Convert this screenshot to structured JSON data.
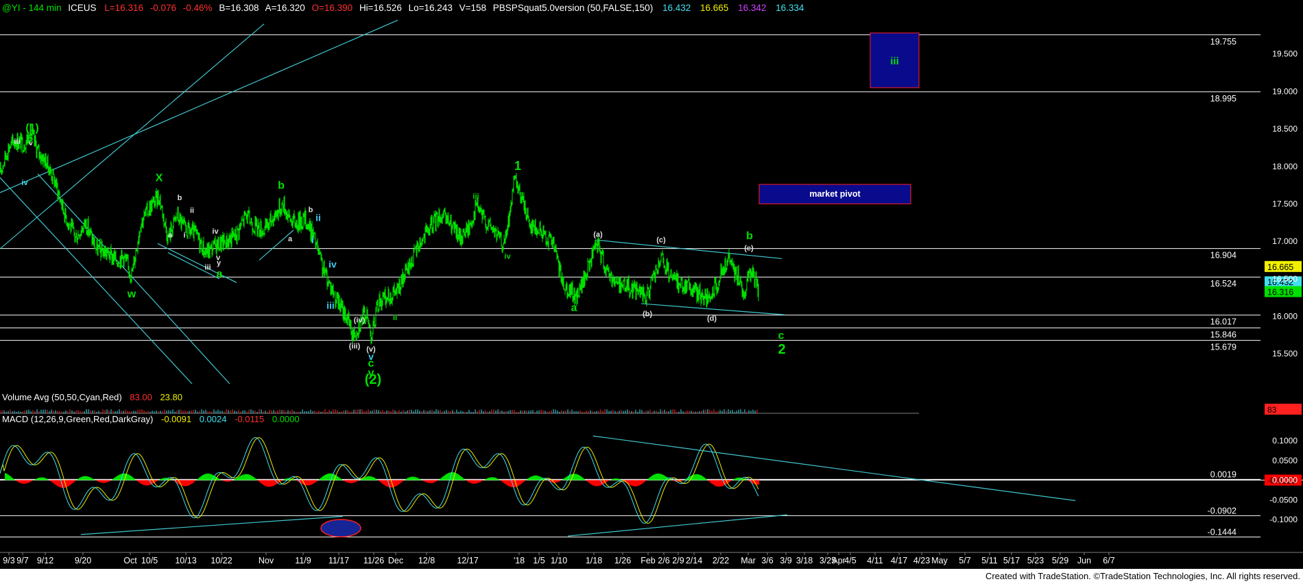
{
  "header": {
    "symbol": "@YI - 144 min",
    "exchange": "ICEUS",
    "last": "L=16.316",
    "change": "-0.076",
    "pct": "-0.46%",
    "bid": "B=16.308",
    "ask": "A=16.320",
    "open": "O=16.390",
    "high": "Hi=16.526",
    "low": "Lo=16.243",
    "volume": "V=158",
    "indicator": "PBSPSquat5.0version (50,FALSE,150)",
    "ind_values": [
      {
        "text": "16.432",
        "color": "#40e0f0"
      },
      {
        "text": "16.665",
        "color": "#f0f000"
      },
      {
        "text": "16.342",
        "color": "#d040ff"
      },
      {
        "text": "16.334",
        "color": "#40e0f0"
      }
    ]
  },
  "volume_panel": {
    "label": "Volume Avg (50,50,Cyan,Red)",
    "v1": "83.00",
    "v2": "23.80",
    "axis_badge": "83"
  },
  "macd_panel": {
    "label": "MACD (12,26,9,Green,Red,DarkGray)",
    "v1": "-0.0091",
    "v2": "0.0024",
    "v3": "-0.0115",
    "v4": "0.0000"
  },
  "footer": {
    "credit": "Created with TradeStation. ©TradeStation Technologies, Inc. All rights reserved."
  },
  "chart_data": {
    "type": "line",
    "symbol": "@YI",
    "interval": "144 min",
    "price_axis": {
      "ylim": [
        15.1,
        20.0
      ],
      "ticks": [
        "19.500",
        "19.000",
        "18.500",
        "18.000",
        "17.500",
        "17.000",
        "16.500",
        "16.000",
        "15.500"
      ]
    },
    "macd_axis": {
      "ylim": [
        -0.18,
        0.14
      ],
      "ticks": [
        "0.1000",
        "0.0500",
        "0.0000",
        "-0.0500",
        "-0.1000"
      ]
    },
    "x_tick_labels": [
      "9/3",
      "9/7",
      "9/12",
      "9/20",
      "Oct",
      "10/5",
      "10/13",
      "10/22",
      "Nov",
      "11/9",
      "11/17",
      "11/26",
      "Dec",
      "12/8",
      "12/17",
      "'18",
      "1/5",
      "1/10",
      "1/18",
      "1/26",
      "Feb",
      "2/6",
      "2/9",
      "2/14",
      "2/22",
      "Mar",
      "3/6",
      "3/9",
      "3/18",
      "3/25",
      "Apr",
      "4/5",
      "4/11",
      "4/17",
      "4/23",
      "May",
      "5/7",
      "5/11",
      "5/17",
      "5/23",
      "5/29",
      "Jun",
      "6/7"
    ],
    "horizontal_levels": [
      {
        "value": 19.755,
        "label": "19.755"
      },
      {
        "value": 18.995,
        "label": "18.995"
      },
      {
        "value": 16.904,
        "label": "16.904"
      },
      {
        "value": 16.524,
        "label": "16.524"
      },
      {
        "value": 16.017,
        "label": "16.017"
      },
      {
        "value": 15.846,
        "label": "15.846"
      },
      {
        "value": 15.679,
        "label": "15.679"
      }
    ],
    "macd_levels": [
      {
        "value": 0.0019,
        "label": "0.0019"
      },
      {
        "value": -0.0902,
        "label": "-0.0902"
      },
      {
        "value": -0.1444,
        "label": "-0.1444"
      }
    ],
    "price_badges": [
      {
        "text": "16.665",
        "value": 16.665,
        "bg": "#f0f000",
        "fg": "#000000"
      },
      {
        "text": "16.432",
        "value": 16.46,
        "bg": "#40e0f0",
        "fg": "#000000"
      },
      {
        "text": "16.316",
        "value": 16.33,
        "bg": "#00e000",
        "fg": "#000000"
      }
    ],
    "macd_badge": {
      "text": "-0.0115",
      "bg": "#ff0000",
      "fg": "#000000"
    },
    "boxes": [
      {
        "label": "market pivot",
        "i0": 1107,
        "i1": 1328,
        "p_hi": 17.76,
        "p_lo": 17.5
      },
      {
        "label": "iii",
        "i0": 1269,
        "i1": 1340,
        "p_hi": 19.78,
        "p_lo": 19.05
      }
    ],
    "price_path": [
      [
        0,
        17.92
      ],
      [
        12,
        18.25
      ],
      [
        22,
        18.35
      ],
      [
        35,
        18.3
      ],
      [
        45,
        18.45
      ],
      [
        55,
        18.2
      ],
      [
        68,
        18.05
      ],
      [
        80,
        17.8
      ],
      [
        95,
        17.35
      ],
      [
        110,
        17.05
      ],
      [
        125,
        17.25
      ],
      [
        140,
        16.9
      ],
      [
        155,
        16.85
      ],
      [
        170,
        16.75
      ],
      [
        180,
        16.8
      ],
      [
        192,
        16.55
      ],
      [
        205,
        17.25
      ],
      [
        218,
        17.45
      ],
      [
        232,
        17.6
      ],
      [
        245,
        17.05
      ],
      [
        258,
        17.35
      ],
      [
        270,
        17.15
      ],
      [
        285,
        17.1
      ],
      [
        300,
        16.85
      ],
      [
        315,
        16.95
      ],
      [
        330,
        17.0
      ],
      [
        345,
        17.1
      ],
      [
        358,
        17.35
      ],
      [
        372,
        17.2
      ],
      [
        386,
        17.15
      ],
      [
        400,
        17.35
      ],
      [
        413,
        17.5
      ],
      [
        422,
        17.3
      ],
      [
        432,
        17.25
      ],
      [
        445,
        17.3
      ],
      [
        458,
        17.05
      ],
      [
        470,
        16.65
      ],
      [
        480,
        16.45
      ],
      [
        492,
        16.2
      ],
      [
        505,
        16.0
      ],
      [
        515,
        15.75
      ],
      [
        525,
        15.92
      ],
      [
        533,
        16.05
      ],
      [
        542,
        15.75
      ],
      [
        552,
        16.2
      ],
      [
        565,
        16.25
      ],
      [
        580,
        16.35
      ],
      [
        596,
        16.65
      ],
      [
        610,
        16.95
      ],
      [
        625,
        17.15
      ],
      [
        640,
        17.35
      ],
      [
        655,
        17.25
      ],
      [
        670,
        17.05
      ],
      [
        685,
        17.2
      ],
      [
        695,
        17.5
      ],
      [
        705,
        17.3
      ],
      [
        720,
        17.15
      ],
      [
        735,
        16.95
      ],
      [
        742,
        17.3
      ],
      [
        750,
        17.8
      ],
      [
        762,
        17.55
      ],
      [
        772,
        17.25
      ],
      [
        785,
        17.15
      ],
      [
        798,
        17.05
      ],
      [
        808,
        16.95
      ],
      [
        818,
        16.5
      ],
      [
        830,
        16.35
      ],
      [
        840,
        16.25
      ],
      [
        852,
        16.5
      ],
      [
        865,
        16.85
      ],
      [
        872,
        16.95
      ],
      [
        885,
        16.6
      ],
      [
        900,
        16.45
      ],
      [
        915,
        16.4
      ],
      [
        930,
        16.35
      ],
      [
        942,
        16.25
      ],
      [
        955,
        16.55
      ],
      [
        965,
        16.75
      ],
      [
        978,
        16.5
      ],
      [
        990,
        16.45
      ],
      [
        1005,
        16.4
      ],
      [
        1020,
        16.3
      ],
      [
        1035,
        16.2
      ],
      [
        1048,
        16.5
      ],
      [
        1062,
        16.75
      ],
      [
        1075,
        16.55
      ],
      [
        1085,
        16.3
      ],
      [
        1092,
        16.6
      ],
      [
        1100,
        16.5
      ],
      [
        1106,
        16.32
      ]
    ],
    "channel_lines": [
      {
        "a": [
          0,
          16.9
        ],
        "b": [
          385,
          19.9
        ]
      },
      {
        "a": [
          0,
          17.65
        ],
        "b": [
          580,
          19.95
        ]
      },
      {
        "a": [
          0,
          17.85
        ],
        "b": [
          280,
          15.1
        ]
      },
      {
        "a": [
          55,
          17.9
        ],
        "b": [
          335,
          15.1
        ]
      },
      {
        "a": [
          230,
          16.97
        ],
        "b": [
          345,
          16.45
        ]
      },
      {
        "a": [
          245,
          16.85
        ],
        "b": [
          320,
          16.5
        ]
      },
      {
        "a": [
          378,
          16.75
        ],
        "b": [
          428,
          17.15
        ]
      },
      {
        "a": [
          868,
          17.02
        ],
        "b": [
          1140,
          16.77
        ]
      },
      {
        "a": [
          935,
          16.17
        ],
        "b": [
          1145,
          16.02
        ]
      }
    ],
    "macd_lines": [
      {
        "a": [
          118,
          -0.138
        ],
        "b": [
          500,
          -0.092
        ]
      },
      {
        "a": [
          828,
          -0.142
        ],
        "b": [
          1148,
          -0.088
        ]
      },
      {
        "a": [
          865,
          0.112
        ],
        "b": [
          1568,
          -0.052
        ]
      }
    ],
    "macd_oval": {
      "cx": 497,
      "cy": -0.122,
      "rx": 29,
      "ry": 0.022
    },
    "wave_labels": [
      {
        "text": "(1)",
        "i": 47,
        "p": 18.47,
        "color": "#00e000",
        "size": 16
      },
      {
        "text": "5",
        "i": 44,
        "p": 18.33,
        "color": "#00e000",
        "size": 15
      },
      {
        "text": "iii",
        "i": 25,
        "p": 18.3,
        "color": "#e0e0e0",
        "size": 11
      },
      {
        "text": "iv",
        "i": 36,
        "p": 17.75,
        "color": "#40e0f0",
        "size": 11
      },
      {
        "text": "v",
        "i": 45,
        "p": 18.28,
        "color": "#e0e0e0",
        "size": 10
      },
      {
        "text": "w",
        "i": 192,
        "p": 16.25,
        "color": "#00e000",
        "size": 16
      },
      {
        "text": "X",
        "i": 232,
        "p": 17.8,
        "color": "#00e000",
        "size": 16
      },
      {
        "text": "b",
        "i": 262,
        "p": 17.55,
        "color": "#e0e0e0",
        "size": 11
      },
      {
        "text": "ii",
        "i": 280,
        "p": 17.38,
        "color": "#e0e0e0",
        "size": 11
      },
      {
        "text": "a",
        "i": 248,
        "p": 17.05,
        "color": "#e0e0e0",
        "size": 11
      },
      {
        "text": "i",
        "i": 269,
        "p": 17.05,
        "color": "#e0e0e0",
        "size": 11
      },
      {
        "text": "iv",
        "i": 314,
        "p": 17.1,
        "color": "#e0e0e0",
        "size": 11
      },
      {
        "text": "iii",
        "i": 303,
        "p": 16.62,
        "color": "#e0e0e0",
        "size": 11
      },
      {
        "text": "v",
        "i": 318,
        "p": 16.75,
        "color": "#e0e0e0",
        "size": 11
      },
      {
        "text": "y",
        "i": 319,
        "p": 16.68,
        "color": "#e0e0e0",
        "size": 11
      },
      {
        "text": "a",
        "i": 320,
        "p": 16.52,
        "color": "#00e000",
        "size": 16
      },
      {
        "text": "b",
        "i": 410,
        "p": 17.7,
        "color": "#00e000",
        "size": 16
      },
      {
        "text": "a",
        "i": 423,
        "p": 17.0,
        "color": "#e0e0e0",
        "size": 11
      },
      {
        "text": "b",
        "i": 453,
        "p": 17.39,
        "color": "#e0e0e0",
        "size": 11
      },
      {
        "text": "ii",
        "i": 464,
        "p": 17.27,
        "color": "#40c8f0",
        "size": 14
      },
      {
        "text": "i",
        "i": 456,
        "p": 16.98,
        "color": "#40c8f0",
        "size": 14
      },
      {
        "text": "iv",
        "i": 485,
        "p": 16.65,
        "color": "#40c8f0",
        "size": 14
      },
      {
        "text": "iii",
        "i": 482,
        "p": 16.1,
        "color": "#40c8f0",
        "size": 14
      },
      {
        "text": "(iv)",
        "i": 524,
        "p": 15.92,
        "color": "#e0e0e0",
        "size": 11
      },
      {
        "text": "(iii)",
        "i": 517,
        "p": 15.57,
        "color": "#e0e0e0",
        "size": 11
      },
      {
        "text": "(v)",
        "i": 541,
        "p": 15.53,
        "color": "#e0e0e0",
        "size": 11
      },
      {
        "text": "v",
        "i": 541,
        "p": 15.42,
        "color": "#40c8f0",
        "size": 14
      },
      {
        "text": "c",
        "i": 541,
        "p": 15.33,
        "color": "#00e000",
        "size": 16
      },
      {
        "text": "y",
        "i": 541,
        "p": 15.2,
        "color": "#00e000",
        "size": 16
      },
      {
        "text": "(2)",
        "i": 544,
        "p": 15.1,
        "color": "#00e000",
        "size": 20
      },
      {
        "text": "ii",
        "i": 576,
        "p": 15.95,
        "color": "#00e000",
        "size": 11
      },
      {
        "text": "iii",
        "i": 694,
        "p": 17.57,
        "color": "#00e000",
        "size": 11
      },
      {
        "text": "iv",
        "i": 740,
        "p": 16.77,
        "color": "#00e000",
        "size": 11
      },
      {
        "text": "1",
        "i": 755,
        "p": 17.95,
        "color": "#00e000",
        "size": 18
      },
      {
        "text": "(a)",
        "i": 872,
        "p": 17.06,
        "color": "#e0e0e0",
        "size": 11
      },
      {
        "text": "a",
        "i": 837,
        "p": 16.07,
        "color": "#00e000",
        "size": 16
      },
      {
        "text": "(c)",
        "i": 964,
        "p": 16.99,
        "color": "#e0e0e0",
        "size": 11
      },
      {
        "text": "(b)",
        "i": 944,
        "p": 16.0,
        "color": "#e0e0e0",
        "size": 11
      },
      {
        "text": "(d)",
        "i": 1038,
        "p": 15.94,
        "color": "#e0e0e0",
        "size": 11
      },
      {
        "text": "(e)",
        "i": 1092,
        "p": 16.88,
        "color": "#e0e0e0",
        "size": 11
      },
      {
        "text": "b",
        "i": 1093,
        "p": 17.03,
        "color": "#00e000",
        "size": 16
      },
      {
        "text": "c",
        "i": 1139,
        "p": 15.7,
        "color": "#00e000",
        "size": 16
      },
      {
        "text": "2",
        "i": 1140,
        "p": 15.5,
        "color": "#00e000",
        "size": 20
      }
    ],
    "colors": {
      "bg": "#000000",
      "price": "#00e000",
      "levels": "#ffffff",
      "channels": "#40c8d0",
      "macd_pos": "#00e000",
      "macd_neg": "#ff0000",
      "macd_line": "#40e0f0",
      "signal_line": "#f0f000",
      "box_fill": "#0a0a8c",
      "box_border": "#ff2020"
    }
  }
}
